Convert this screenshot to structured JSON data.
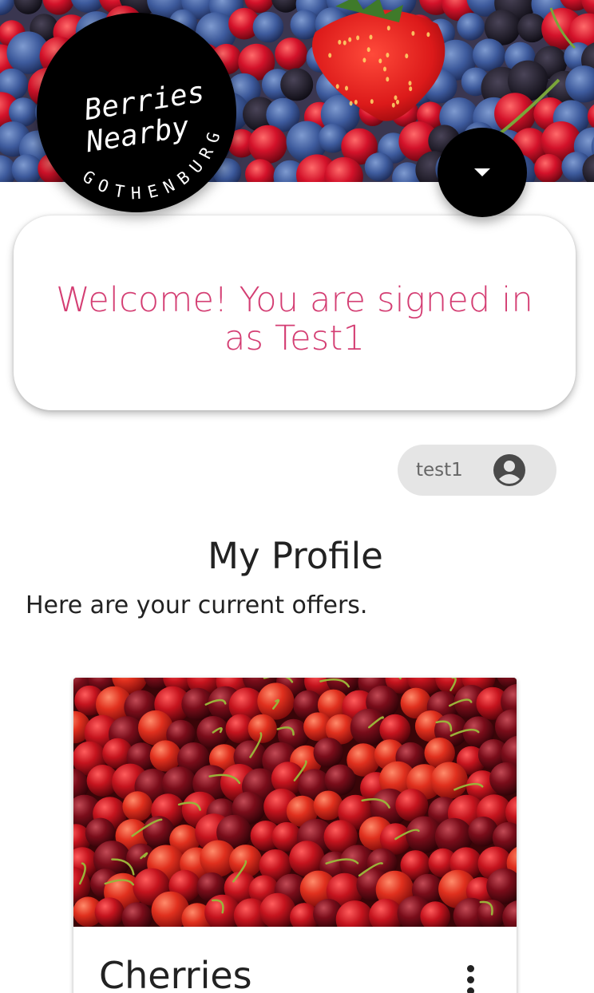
{
  "header": {
    "logo": {
      "line1": "Berries",
      "line2": "Nearby",
      "ring_text": "GOTHENBURG"
    },
    "menu_button_icon": "caret-down-icon"
  },
  "welcome": {
    "message": "Welcome! You are signed in as Test1"
  },
  "user_chip": {
    "username": "test1",
    "icon": "account-circle-icon"
  },
  "profile": {
    "title": "My Profile",
    "subtitle": "Here are your current offers."
  },
  "offers": [
    {
      "title": "Cherries",
      "menu_icon": "more-vert-icon"
    }
  ],
  "colors": {
    "accent": "#d43e73",
    "chip_background": "#e5e5e5",
    "logo_background": "#000000"
  }
}
